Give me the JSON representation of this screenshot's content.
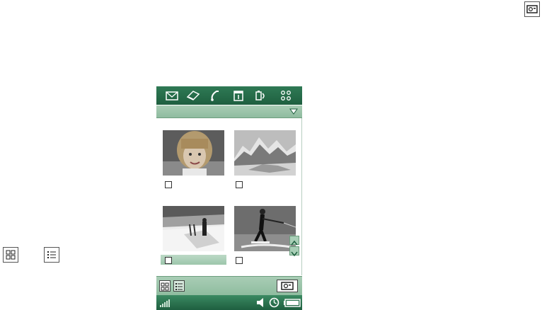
{
  "screen": {
    "title": "",
    "colors": {
      "header_dark": "#1e5f3f",
      "header_light": "#2f7a55",
      "bar_light": "#a9cdb5",
      "selection": "#9cc6ab"
    }
  },
  "topbar": {
    "icons": [
      "mail-icon",
      "notes-icon",
      "phone-icon",
      "calendar-icon",
      "media-icon",
      "apps-grid-icon"
    ]
  },
  "gallery": {
    "items": [
      {
        "name": "photo-girl",
        "checked": false,
        "selected": false
      },
      {
        "name": "photo-mountains",
        "checked": false,
        "selected": false
      },
      {
        "name": "photo-skier",
        "checked": false,
        "selected": true
      },
      {
        "name": "photo-waterskier",
        "checked": false,
        "selected": false
      }
    ]
  },
  "bottombar": {
    "icons": [
      "thumbnail-view-icon",
      "list-view-icon",
      "camera-icon"
    ]
  },
  "statusbar": {
    "icons": [
      "signal-icon",
      "speaker-icon",
      "clock-icon",
      "battery-icon"
    ]
  },
  "external_icons": [
    "camera-icon",
    "thumbnail-view-icon",
    "list-view-icon"
  ]
}
